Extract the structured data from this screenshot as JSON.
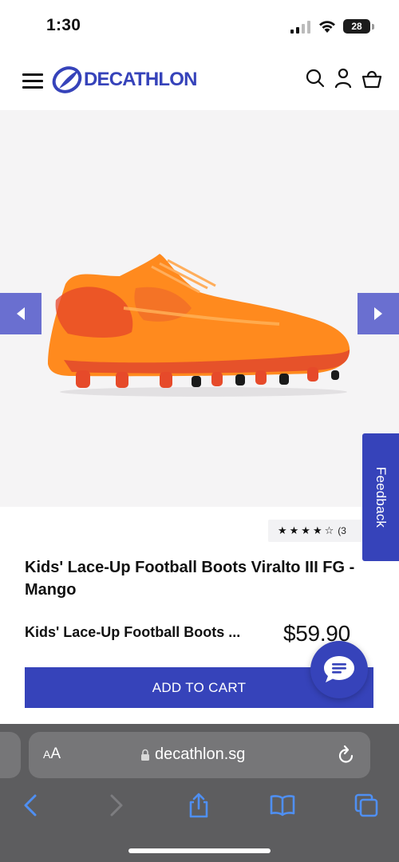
{
  "status_bar": {
    "time": "1:30",
    "battery_level": "28"
  },
  "header": {
    "brand": "DECATHLON",
    "icons": [
      "menu-icon",
      "search-icon",
      "account-icon",
      "basket-icon"
    ]
  },
  "gallery": {
    "prev_icon": "chevron-left-icon",
    "next_icon": "chevron-right-icon"
  },
  "feedback_label": "Feedback",
  "product": {
    "rating_stars": "★★★★☆",
    "rating_count": "(3",
    "title": "Kids' Lace-Up Football Boots Viralto III FG - Mango",
    "short_name": "Kids' Lace-Up Football Boots ...",
    "price": "$59.90",
    "cta": "ADD TO CART"
  },
  "browser": {
    "aa_label_small": "A",
    "aa_label_big": "A",
    "url": "decathlon.sg"
  },
  "colors": {
    "brand": "#3643ba",
    "arrow_bg": "#6a6fd0",
    "boot_orange": "#ff8a1e",
    "browser_bar": "#5d5d5f",
    "browser_accent": "#4f8ff2"
  }
}
